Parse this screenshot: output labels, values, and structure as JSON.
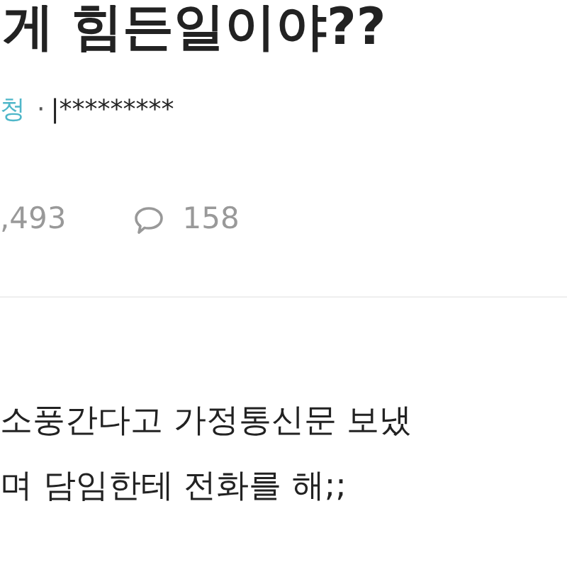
{
  "post": {
    "title": "게 힘든일이야??",
    "author": "청",
    "separator": "·",
    "date": "|*********",
    "views": ",493",
    "comments": "158",
    "body": [
      "소풍간다고 가정통신문 보냈",
      "며 담임한테 전화를 해;;"
    ]
  }
}
